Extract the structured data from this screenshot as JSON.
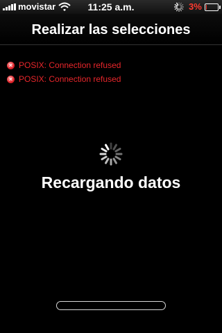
{
  "status_bar": {
    "carrier": "movistar",
    "time": "11:25 a.m.",
    "battery_percent": "3%",
    "battery_level": 0.03,
    "icons": [
      "signal-icon",
      "wifi-icon",
      "activity-spinner-icon",
      "battery-icon"
    ],
    "colors": {
      "battery_low": "#ff3b30"
    }
  },
  "nav": {
    "title": "Realizar las selecciones"
  },
  "errors": [
    {
      "icon": "error-x-icon",
      "message": "POSIX: Connection refused"
    },
    {
      "icon": "error-x-icon",
      "message": "POSIX: Connection refused"
    }
  ],
  "loading": {
    "icon": "spinner-icon",
    "text": "Recargando datos"
  },
  "progress": {
    "value": 0
  },
  "colors": {
    "background": "#000000",
    "error_text": "#e8262b",
    "text": "#ffffff"
  }
}
